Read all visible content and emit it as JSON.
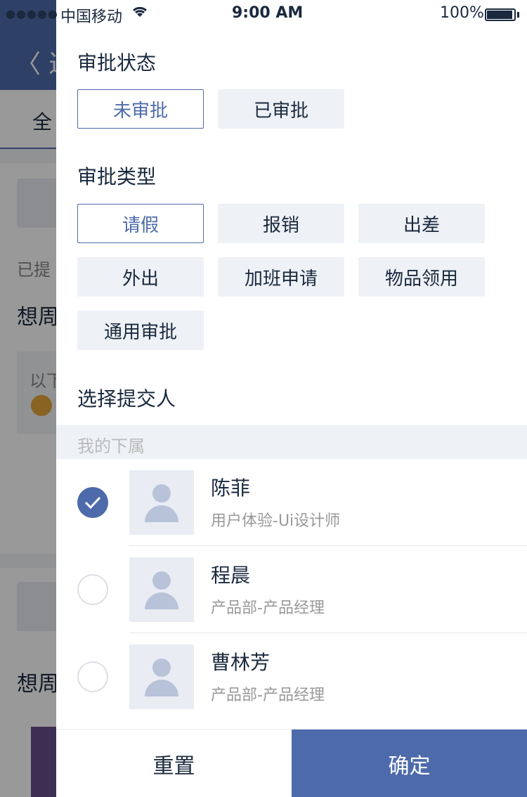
{
  "status_bar": {
    "signal": "●●●●●",
    "carrier": "中国移动",
    "wifi_icon": "wifi-icon",
    "time": "9:00 AM",
    "battery": "100%"
  },
  "background": {
    "back_label": "〈 返",
    "tab_all": "全",
    "submitted_prefix": "已提",
    "title_1": "想周",
    "quote_prefix": "以下",
    "title_2": "想周"
  },
  "filter": {
    "approval_status": {
      "title": "审批状态",
      "options": [
        "未审批",
        "已审批"
      ],
      "selected": "未审批"
    },
    "approval_type": {
      "title": "审批类型",
      "options": [
        "请假",
        "报销",
        "出差",
        "外出",
        "加班申请",
        "物品领用",
        "通用审批"
      ],
      "selected": "请假"
    },
    "submitter": {
      "title": "选择提交人",
      "group_label": "我的下属",
      "people": [
        {
          "name": "陈菲",
          "title": "用户体验-Ui设计师",
          "checked": true
        },
        {
          "name": "程晨",
          "title": "产品部-产品经理",
          "checked": false
        },
        {
          "name": "曹林芳",
          "title": "产品部-产品经理",
          "checked": false
        }
      ]
    },
    "actions": {
      "reset": "重置",
      "confirm": "确定"
    }
  },
  "colors": {
    "text_primary": "#1A293E",
    "accent": "#4D6BAB",
    "chip_bg": "#EEF1F6",
    "placeholder": "#BABABA",
    "secondary": "#999999",
    "white": "#FFFFFF"
  }
}
